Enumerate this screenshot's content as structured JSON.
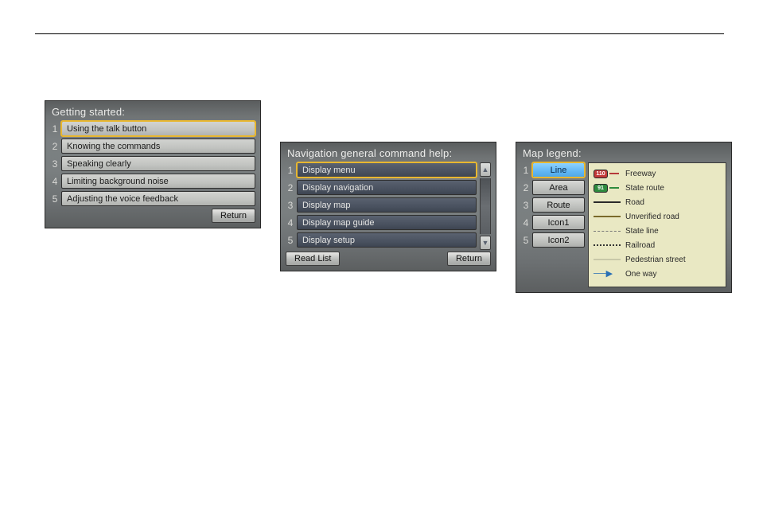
{
  "panel1": {
    "title": "Getting started:",
    "items": [
      "Using the talk button",
      "Knowing the commands",
      "Speaking clearly",
      "Limiting background noise",
      "Adjusting the voice feedback"
    ],
    "return": "Return"
  },
  "panel2": {
    "title": "Navigation general command help:",
    "items": [
      "Display menu",
      "Display navigation",
      "Display map",
      "Display map guide",
      "Display setup"
    ],
    "readlist": "Read List",
    "return": "Return",
    "scroll_up": "▲",
    "scroll_down": "▼"
  },
  "panel3": {
    "title": "Map legend:",
    "buttons": [
      "Line",
      "Area",
      "Route",
      "Icon1",
      "Icon2"
    ],
    "legend": {
      "freeway": {
        "label": "Freeway",
        "badge": "110"
      },
      "stateroute": {
        "label": "State route",
        "badge": "91"
      },
      "road": "Road",
      "unverified": "Unverified road",
      "stateline": "State line",
      "railroad": "Railroad",
      "pedestrian": "Pedestrian street",
      "oneway": "One way"
    }
  }
}
